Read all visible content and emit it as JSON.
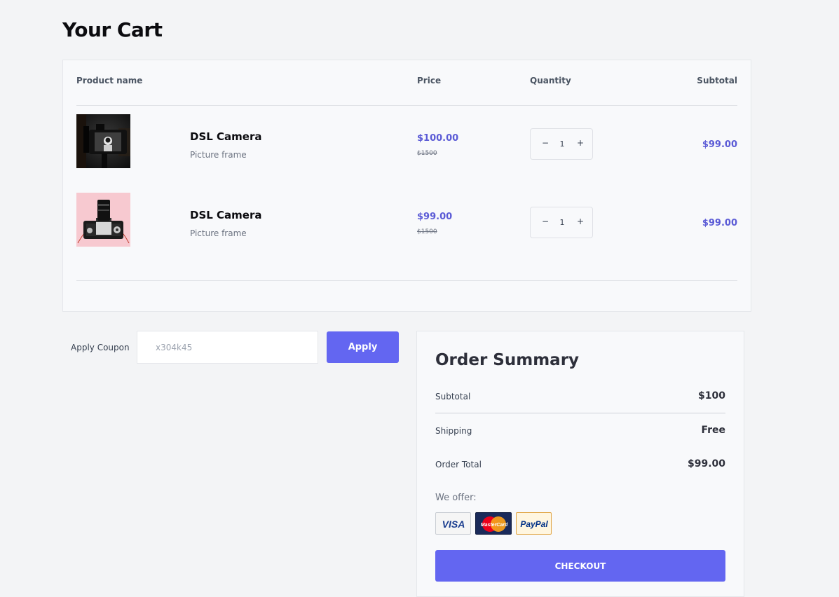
{
  "page": {
    "title": "Your Cart"
  },
  "table": {
    "headers": {
      "product": "Product name",
      "price": "Price",
      "quantity": "Quantity",
      "subtotal": "Subtotal"
    },
    "rows": [
      {
        "name": "DSL Camera",
        "desc": "Picture frame",
        "price": "$100.00",
        "old_price": "$1500",
        "qty": "1",
        "subtotal": "$99.00",
        "image_icon": "camera-back-photo"
      },
      {
        "name": "DSL Camera",
        "desc": "Picture frame",
        "price": "$99.00",
        "old_price": "$1500",
        "qty": "1",
        "subtotal": "$99.00",
        "image_icon": "camera-front-photo"
      }
    ],
    "stepper": {
      "minus": "−",
      "plus": "+"
    }
  },
  "coupon": {
    "label": "Apply Coupon",
    "placeholder": "x304k45",
    "button": "Apply"
  },
  "summary": {
    "title": "Order Summary",
    "subtotal_label": "Subtotal",
    "subtotal_value": "$100",
    "shipping_label": "Shipping",
    "shipping_value": "Free",
    "total_label": "Order Total",
    "total_value": "$99.00",
    "offer_label": "We offer:",
    "payment_methods": [
      "VISA",
      "MasterCard",
      "PayPal"
    ],
    "checkout": "CHECKOUT"
  },
  "colors": {
    "accent": "#6366f1",
    "price_text": "#5b5bd6",
    "background": "#f3f4f6",
    "card": "#f8f9fb"
  }
}
